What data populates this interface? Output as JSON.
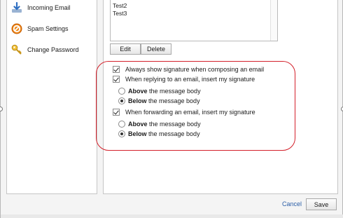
{
  "sidebar": {
    "items": [
      {
        "label": "Incoming Email",
        "icon": "download-arrow-icon"
      },
      {
        "label": "Spam Settings",
        "icon": "no-entry-icon"
      },
      {
        "label": "Change Password",
        "icon": "key-icon"
      }
    ]
  },
  "signatures": {
    "items": [
      "Test2",
      "Test3"
    ],
    "edit_label": "Edit",
    "delete_label": "Delete"
  },
  "options": {
    "always_show": {
      "label": "Always show signature when composing an email",
      "checked": true
    },
    "reply": {
      "label": "When replying to an email, insert my signature",
      "checked": true,
      "above": {
        "bold": "Above",
        "rest": " the message body",
        "selected": false
      },
      "below": {
        "bold": "Below",
        "rest": " the message body",
        "selected": true
      }
    },
    "forward": {
      "label": "When forwarding an email, insert my signature",
      "checked": true,
      "above": {
        "bold": "Above",
        "rest": " the message body",
        "selected": false
      },
      "below": {
        "bold": "Below",
        "rest": " the message body",
        "selected": true
      }
    }
  },
  "footer": {
    "cancel_label": "Cancel",
    "save_label": "Save"
  },
  "colors": {
    "highlight_outline": "#d3202a",
    "link": "#2b5ea7"
  }
}
